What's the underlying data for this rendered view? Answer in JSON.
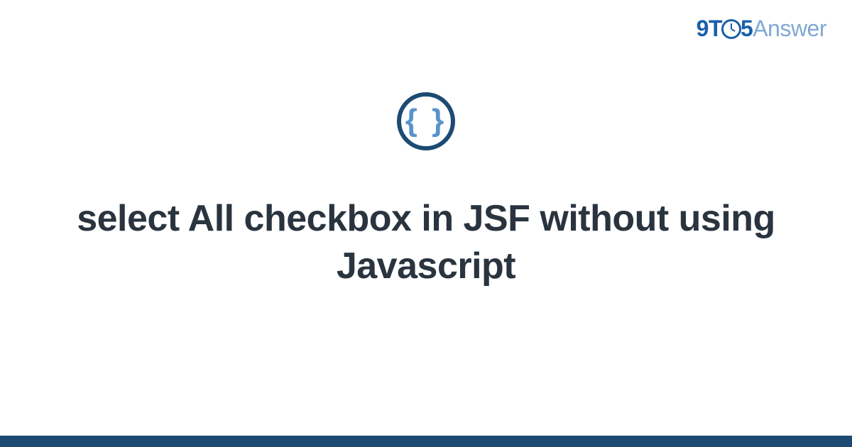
{
  "logo": {
    "part1": "9",
    "part2": "T",
    "part3": "5",
    "part4": "Answer"
  },
  "icon": {
    "glyph": "{ }"
  },
  "title": "select All checkbox in JSF without using Javascript"
}
